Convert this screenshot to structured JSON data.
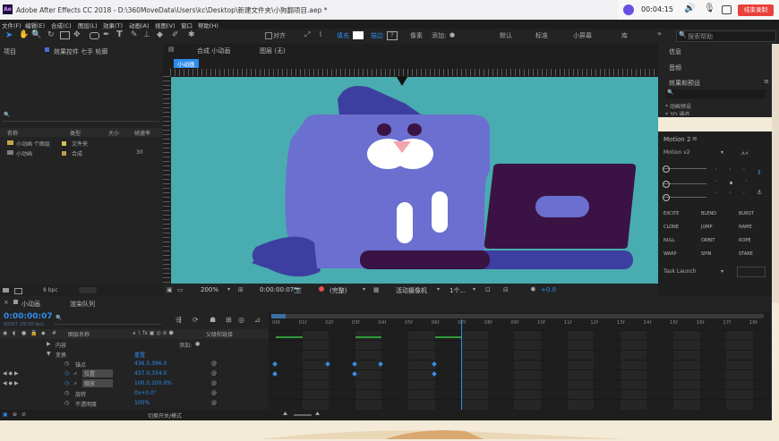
{
  "window": {
    "title": "Adobe After Effects CC 2018 - D:\\360MoveData\\Users\\kc\\Desktop\\新建文件夹\\小狗翻项目.aep *",
    "recording_time": "00:04:15",
    "end_recording_label": "结束录制"
  },
  "menu": [
    "文件(F)",
    "编辑(E)",
    "合成(C)",
    "图层(L)",
    "效果(T)",
    "动画(A)",
    "视图(V)",
    "窗口",
    "帮助(H)"
  ],
  "toolbar": {
    "snap_label": "对齐",
    "fill_label": "填充",
    "stroke_label": "描边",
    "pixel_label": "像素",
    "add_label": "添加:",
    "default_label": "默认",
    "standard_label": "标准",
    "small_screen_label": "小屏幕",
    "libraries_label": "库",
    "search_placeholder": "搜索帮助"
  },
  "project_panel": {
    "tab_project": "项目",
    "tab_effects": "效果控件 七手 轮廓",
    "columns": [
      "名称",
      "类型",
      "大小",
      "帧速率"
    ],
    "items": [
      {
        "name": "小动画 个图层",
        "type": "文件夹",
        "size": "",
        "fps": ""
      },
      {
        "name": "小动画",
        "type": "合成",
        "size": "",
        "fps": "30"
      }
    ],
    "bpc": "8 bpc"
  },
  "composition_panel": {
    "tab_label": "合成 小动画",
    "layer_tab": "图层 (无)",
    "breadcrumb": "小动画",
    "zoom": "200%",
    "timecode": "0:00:00:07",
    "resolution": "(完整)",
    "camera": "活动摄像机",
    "views": "1个...",
    "exposure": "+0.0"
  },
  "right_panels": {
    "info": "信息",
    "audio": "音频",
    "effects_presets": "效果和预设",
    "search_placeholder": "",
    "presets_items": [
      "* 动画预设",
      "* 3D 通道"
    ]
  },
  "motion_panel": {
    "title": "Motion 2",
    "version": "Motion v2",
    "buttons": [
      "EXCITE",
      "BLEND",
      "BURST",
      "CLONE",
      "JUMP",
      "NAME",
      "NULL",
      "ORBIT",
      "ROPE",
      "WARP",
      "SPIN",
      "STARE"
    ],
    "task_label": "Task Launch"
  },
  "timeline": {
    "tab_comp": "小动画",
    "tab_render": "渲染队列",
    "timecode": "0:00:00:07",
    "fps_info": "00007 (30.00 fps)",
    "col_layer_name": "图层名称",
    "col_parent": "父级和链接",
    "rows": [
      {
        "label": "内容",
        "value": "",
        "extra": "添加:"
      },
      {
        "label": "变换",
        "value": "重置",
        "extra": ""
      },
      {
        "label": "锚点",
        "value": "436.5,396.0",
        "extra": ""
      },
      {
        "label": "位置",
        "value": "437.0,334.0",
        "extra": ""
      },
      {
        "label": "缩放",
        "value": "100.0,100.0%",
        "extra": ""
      },
      {
        "label": "旋转",
        "value": "0x+0.0°",
        "extra": ""
      },
      {
        "label": "不透明度",
        "value": "100%",
        "extra": ""
      }
    ],
    "ruler": [
      "00f",
      "01f",
      "02f",
      "03f",
      "04f",
      "05f",
      "06f",
      "07f",
      "08f",
      "09f",
      "10f",
      "11f",
      "12f",
      "13f",
      "14f",
      "15f",
      "16f",
      "17f",
      "18f"
    ],
    "footer": "切换开关/模式",
    "position_keyframes": [
      0,
      2,
      3,
      4,
      6
    ],
    "scale_keyframes": [
      0,
      3,
      6
    ]
  },
  "colors": {
    "canvas_bg": "#49acb0",
    "cat_body": "#6b6fcf",
    "cat_dark": "#3d3fa0",
    "laptop": "#3a1344",
    "accent": "#2d8ceb"
  }
}
